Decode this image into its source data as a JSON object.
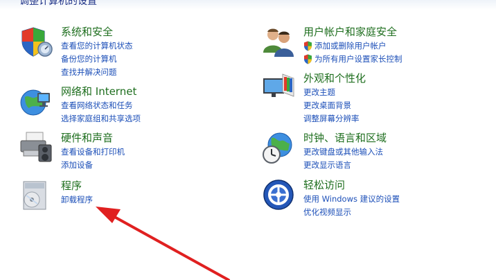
{
  "page": {
    "heading": "调整计算机的设置"
  },
  "categories": [
    {
      "title": "系统和安全",
      "links": [
        "查看您的计算机状态",
        "备份您的计算机",
        "查找并解决问题"
      ],
      "icon": "shield-icon"
    },
    {
      "title": "网络和 Internet",
      "links": [
        "查看网络状态和任务",
        "选择家庭组和共享选项"
      ],
      "icon": "network-globe-icon"
    },
    {
      "title": "硬件和声音",
      "links": [
        "查看设备和打印机",
        "添加设备"
      ],
      "icon": "printer-icon"
    },
    {
      "title": "程序",
      "links": [
        "卸载程序"
      ],
      "icon": "programs-icon"
    },
    {
      "title": "用户帐户和家庭安全",
      "links": [
        "添加或删除用户帐户",
        "为所有用户设置家长控制"
      ],
      "icon": "users-icon"
    },
    {
      "title": "外观和个性化",
      "links": [
        "更改主题",
        "更改桌面背景",
        "调整屏幕分辨率"
      ],
      "icon": "appearance-icon"
    },
    {
      "title": "时钟、语言和区域",
      "links": [
        "更改键盘或其他输入法",
        "更改显示语言"
      ],
      "icon": "clock-globe-icon"
    },
    {
      "title": "轻松访问",
      "links": [
        "使用 Windows 建议的设置",
        "优化视频显示"
      ],
      "icon": "ease-of-access-icon"
    }
  ],
  "colors": {
    "title_green": "#1e6e1e",
    "link_blue": "#1c4fb8",
    "annotation_red": "#e02020"
  }
}
